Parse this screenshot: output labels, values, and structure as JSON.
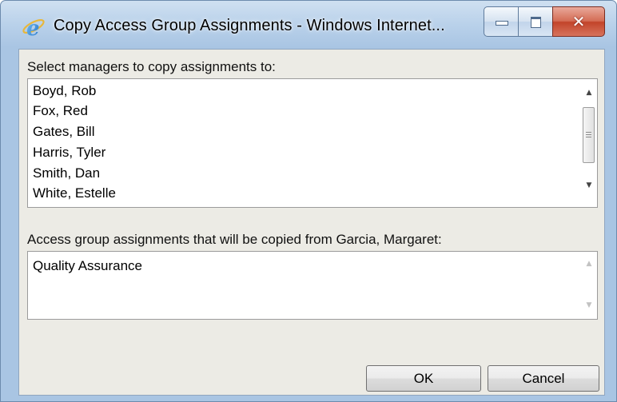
{
  "window": {
    "title": "Copy Access Group Assignments - Windows Internet..."
  },
  "managers": {
    "label": "Select managers to copy assignments to:",
    "items": [
      "Boyd, Rob",
      "Fox, Red",
      "Gates, Bill",
      "Harris, Tyler",
      "Smith, Dan",
      "White, Estelle"
    ]
  },
  "assignments": {
    "label": "Access group assignments that will be copied from Garcia, Margaret:",
    "items": [
      "Quality Assurance"
    ]
  },
  "buttons": {
    "ok": "OK",
    "cancel": "Cancel"
  },
  "icons": {
    "app": "internet-explorer-icon",
    "minimize": "minimize-icon",
    "maximize": "maximize-icon",
    "close": "close-icon",
    "scroll_up": "up-arrow-icon",
    "scroll_down": "down-arrow-icon"
  }
}
